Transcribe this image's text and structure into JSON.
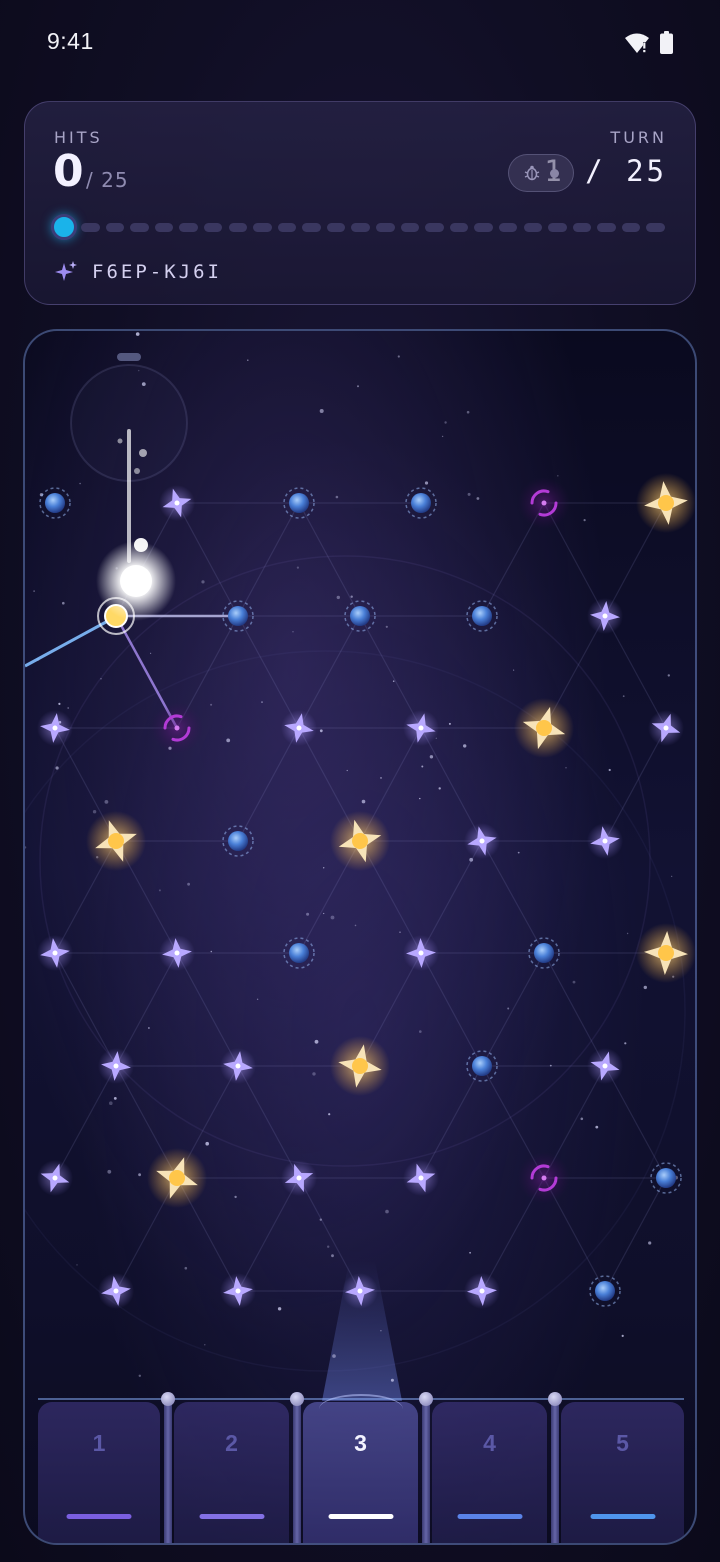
{
  "status_bar": {
    "time": "9:41"
  },
  "header": {
    "hits_label": "HITS",
    "hits_value": "0",
    "hits_total": "/ 25",
    "turn_label": "TURN",
    "turn_value": "1 / 25",
    "progress": {
      "current_turn": 1,
      "total_turns": 25
    },
    "seed_code": "F6EP-KJ6I"
  },
  "board": {
    "star_colors": {
      "violet": "#b8a8ff",
      "gold": "#ffc64a",
      "orb": "#4f86e0",
      "portal": "#b33bd6"
    },
    "launcher_icon": "aim-dial-icon",
    "ball_icon": "glowing-ball-icon"
  },
  "slots": [
    {
      "label": "1",
      "bar_color": "#7a5fe0"
    },
    {
      "label": "2",
      "bar_color": "#8370e4"
    },
    {
      "label": "3",
      "bar_color": "#ffffff",
      "active": true
    },
    {
      "label": "4",
      "bar_color": "#5a83e8"
    },
    {
      "label": "5",
      "bar_color": "#4f95ec"
    }
  ]
}
